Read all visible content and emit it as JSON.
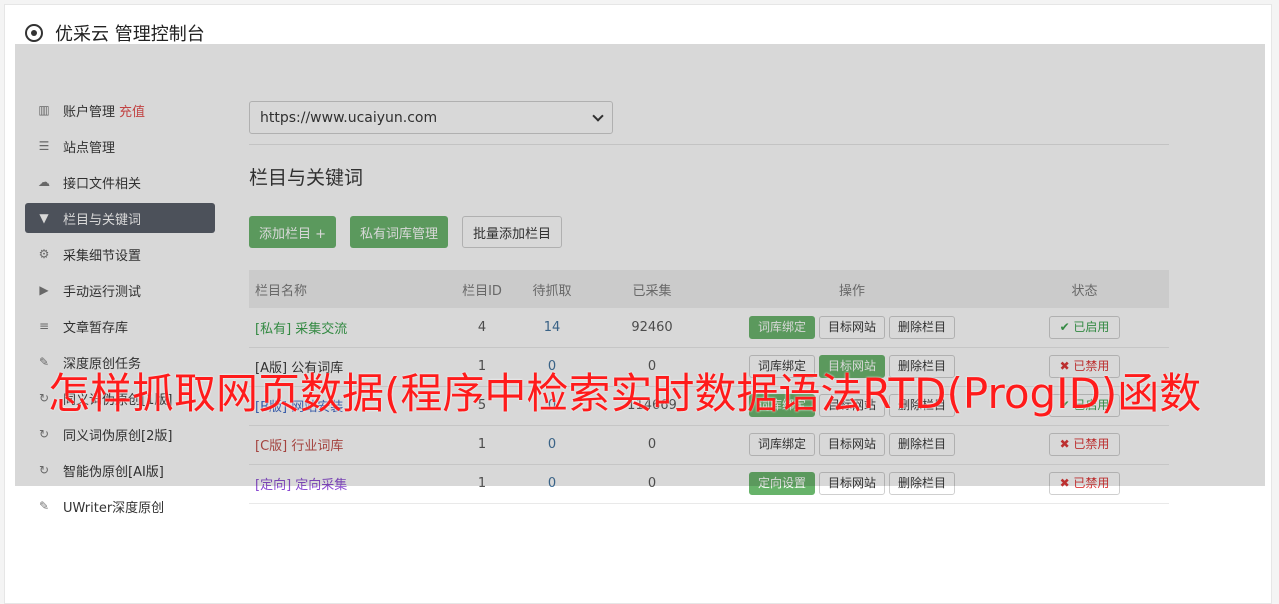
{
  "app": {
    "title": "优采云 管理控制台"
  },
  "sidebar": {
    "items": [
      {
        "label": "账户管理",
        "badge": "充值",
        "icon": "bar-chart-icon"
      },
      {
        "label": "站点管理",
        "icon": "server-icon"
      },
      {
        "label": "接口文件相关",
        "icon": "cloud-upload-icon"
      },
      {
        "label": "栏目与关键词",
        "icon": "filter-icon",
        "active": true
      },
      {
        "label": "采集细节设置",
        "icon": "cogs-icon"
      },
      {
        "label": "手动运行测试",
        "icon": "play-circle-icon"
      },
      {
        "label": "文章暂存库",
        "icon": "database-icon"
      },
      {
        "label": "深度原创任务",
        "icon": "edit-icon"
      },
      {
        "label": "同义词伪原创[1版]",
        "icon": "refresh-icon"
      },
      {
        "label": "同义词伪原创[2版]",
        "icon": "refresh-icon"
      },
      {
        "label": "智能伪原创[AI版]",
        "icon": "refresh-icon"
      },
      {
        "label": "UWriter深度原创",
        "icon": "edit-icon"
      }
    ]
  },
  "content": {
    "site_select": "https://www.ucaiyun.com",
    "section_title": "栏目与关键词",
    "buttons": {
      "add": "添加栏目 +",
      "private": "私有词库管理",
      "batch": "批量添加栏目"
    },
    "table": {
      "headers": {
        "name": "栏目名称",
        "id": "栏目ID",
        "wait": "待抓取",
        "collected": "已采集",
        "ops": "操作",
        "status": "状态"
      },
      "rows": [
        {
          "tag": "[私有]",
          "name": "采集交流",
          "id": "4",
          "wait": "14",
          "collected": "92460",
          "op1": "词库绑定",
          "op2": "目标网站",
          "op3": "删除栏目",
          "status": "✔ 已启用"
        },
        {
          "tag": "[A版]",
          "name": "公有词库",
          "id": "1",
          "wait": "0",
          "collected": "0",
          "op1": "词库绑定",
          "op2": "目标网站",
          "op3": "删除栏目",
          "status": "✖ 已禁用"
        },
        {
          "tag": "[B版]",
          "name": "网站安装",
          "id": "5",
          "wait": "0",
          "collected": "114669",
          "op1": "词库绑定",
          "op2": "目标网站",
          "op3": "删除栏目",
          "status": "✔ 已启用"
        },
        {
          "tag": "[C版]",
          "name": "行业词库",
          "id": "1",
          "wait": "0",
          "collected": "0",
          "op1": "词库绑定",
          "op2": "目标网站",
          "op3": "删除栏目",
          "status": "✖ 已禁用"
        },
        {
          "tag": "[定向]",
          "name": "定向采集",
          "id": "1",
          "wait": "0",
          "collected": "0",
          "op1": "定向设置",
          "op2": "目标网站",
          "op3": "删除栏目",
          "status": "✖ 已禁用"
        }
      ]
    }
  },
  "overlay_text": "怎样抓取网页数据(程序中检索实时数据语法RTD(ProgID)函数"
}
